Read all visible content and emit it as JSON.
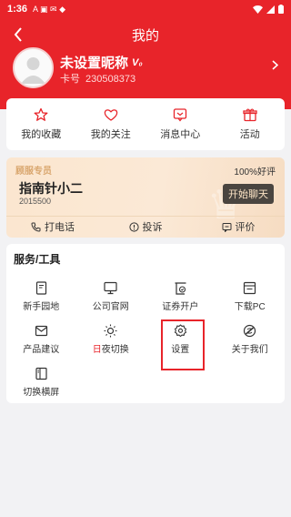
{
  "status_bar": {
    "time": "1:36",
    "left_icons": "A ▣ ✉ ◆"
  },
  "header": {
    "title": "我的",
    "nickname": "未设置昵称",
    "v_badge": "V₀",
    "card_label": "卡号",
    "card_number": "230508373"
  },
  "quick_links": [
    {
      "label": "我的收藏",
      "icon": "star-icon"
    },
    {
      "label": "我的关注",
      "icon": "heart-icon"
    },
    {
      "label": "消息中心",
      "icon": "message-icon"
    },
    {
      "label": "活动",
      "icon": "gift-icon"
    }
  ],
  "service_card": {
    "tag": "顾服专员",
    "rating": "100%好评",
    "name": "指南针小二",
    "id": "2015500",
    "chat_button": "开始聊天",
    "actions": [
      {
        "label": "打电话",
        "icon": "phone-icon"
      },
      {
        "label": "投诉",
        "icon": "warning-icon"
      },
      {
        "label": "评价",
        "icon": "review-icon"
      }
    ]
  },
  "tools": {
    "title": "服务/工具",
    "items": [
      {
        "label": "新手园地",
        "icon": "book-icon"
      },
      {
        "label": "公司官网",
        "icon": "monitor-icon"
      },
      {
        "label": "证券开户",
        "icon": "account-open-icon"
      },
      {
        "label": "下载PC",
        "icon": "download-pc-icon"
      },
      {
        "label": "产品建议",
        "icon": "mail-icon"
      },
      {
        "label_prefix": "日",
        "label_rest": "夜切换",
        "icon": "sun-icon"
      },
      {
        "label": "设置",
        "icon": "settings-icon",
        "highlighted": true
      },
      {
        "label": "关于我们",
        "icon": "about-icon"
      },
      {
        "label": "切换横屏",
        "icon": "rotate-screen-icon"
      }
    ]
  },
  "colors": {
    "brand_red": "#e8242a",
    "background": "#f2f2f4",
    "card_gold": "#fbe6cf",
    "chat_button_bg": "#4a4540"
  }
}
